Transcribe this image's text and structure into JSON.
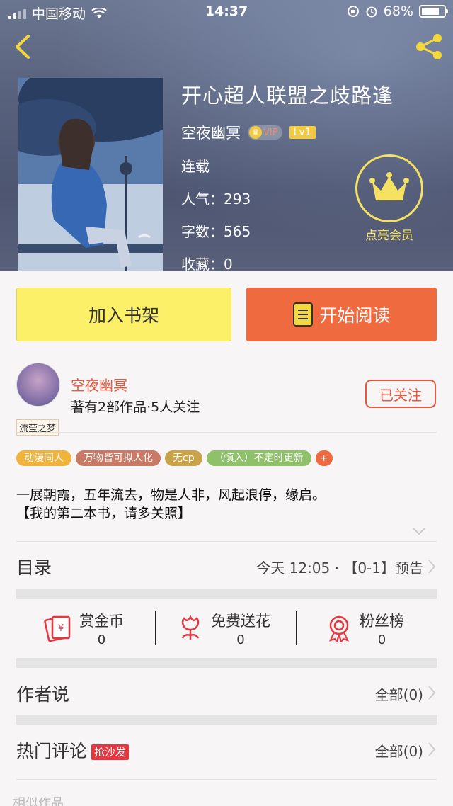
{
  "status_bar": {
    "carrier": "中国移动",
    "time": "14:37",
    "battery": "68%"
  },
  "book": {
    "title": "开心超人联盟之歧路逢",
    "author": "空夜幽冥",
    "vip_label": "VIP",
    "level_label": "Lv1",
    "status": "连载",
    "popularity": "人气：293",
    "word_count": "字数：565",
    "favorites": "收藏：0"
  },
  "membership": {
    "label": "点亮会员"
  },
  "actions": {
    "add_shelf": "加入书架",
    "start_reading": "开始阅读"
  },
  "author_card": {
    "avatar_tag": "流莹之梦",
    "name": "空夜幽冥",
    "meta": "著有2部作品·5人关注",
    "follow_label": "已关注"
  },
  "tags": [
    {
      "label": "动漫同人",
      "color": "#f0b33c"
    },
    {
      "label": "万物皆可拟人化",
      "color": "#c97a66"
    },
    {
      "label": "无cp",
      "color": "#c9a24a"
    },
    {
      "label": "（慎入）不定时更新",
      "color": "#8fc06a"
    },
    {
      "label": "+",
      "color": "#ef6a3f"
    }
  ],
  "description": {
    "line1": "一展朝霞，五年流去，物是人非，风起浪停，缘启。",
    "line2": "【我的第二本书，请多关照】"
  },
  "catalog": {
    "title": "目录",
    "latest": "今天 12:05 · 【0-1】预告"
  },
  "stats": {
    "reward": {
      "label": "赏金币",
      "value": "0"
    },
    "flowers": {
      "label": "免费送花",
      "value": "0"
    },
    "fans": {
      "label": "粉丝榜",
      "value": "0"
    }
  },
  "author_says": {
    "title": "作者说",
    "count": "全部(0)"
  },
  "hot_comments": {
    "title": "热门评论",
    "badge": "抢沙发",
    "count": "全部(0)"
  },
  "similar": {
    "title": "相似作品"
  },
  "colors": {
    "accent": "#ef6a3f",
    "yellow": "#fbf068",
    "red": "#e8563f",
    "crown": "#f5e162"
  }
}
